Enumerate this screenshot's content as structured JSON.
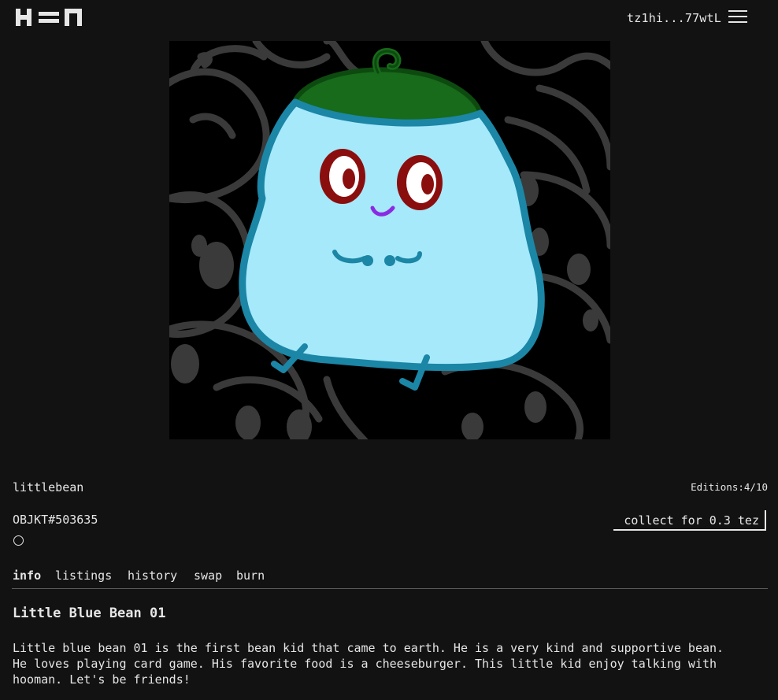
{
  "header": {
    "logo_text": "H=N",
    "wallet_address": "tz1hi...77wtL",
    "menu_icon": "hamburger-menu-icon"
  },
  "artwork": {
    "description": "illustration"
  },
  "token": {
    "creator": "littlebean",
    "editions": "Editions:4/10",
    "objkt_id": "OBJKT#503635",
    "collect_label": "collect for 0.3 tez"
  },
  "tabs": [
    {
      "label": "info",
      "active": true
    },
    {
      "label": "listings",
      "active": false
    },
    {
      "label": "history",
      "active": false
    },
    {
      "label": "swap",
      "active": false
    },
    {
      "label": "burn",
      "active": false
    }
  ],
  "info": {
    "title": "Little Blue Bean 01",
    "description": "Little blue bean 01 is the first bean kid that came to earth. He is a very kind and supportive bean.\nHe loves playing card game. His favorite food is a cheeseburger. This little kid enjoy talking with\nhooman. Let's be friends!"
  },
  "colors": {
    "background": "#121212",
    "text": "#e6e6e6",
    "bean_body": "#a6e9fb",
    "bean_outline": "#1b86a5",
    "hat": "#176b1a",
    "eye_red": "#8b0e0e"
  }
}
